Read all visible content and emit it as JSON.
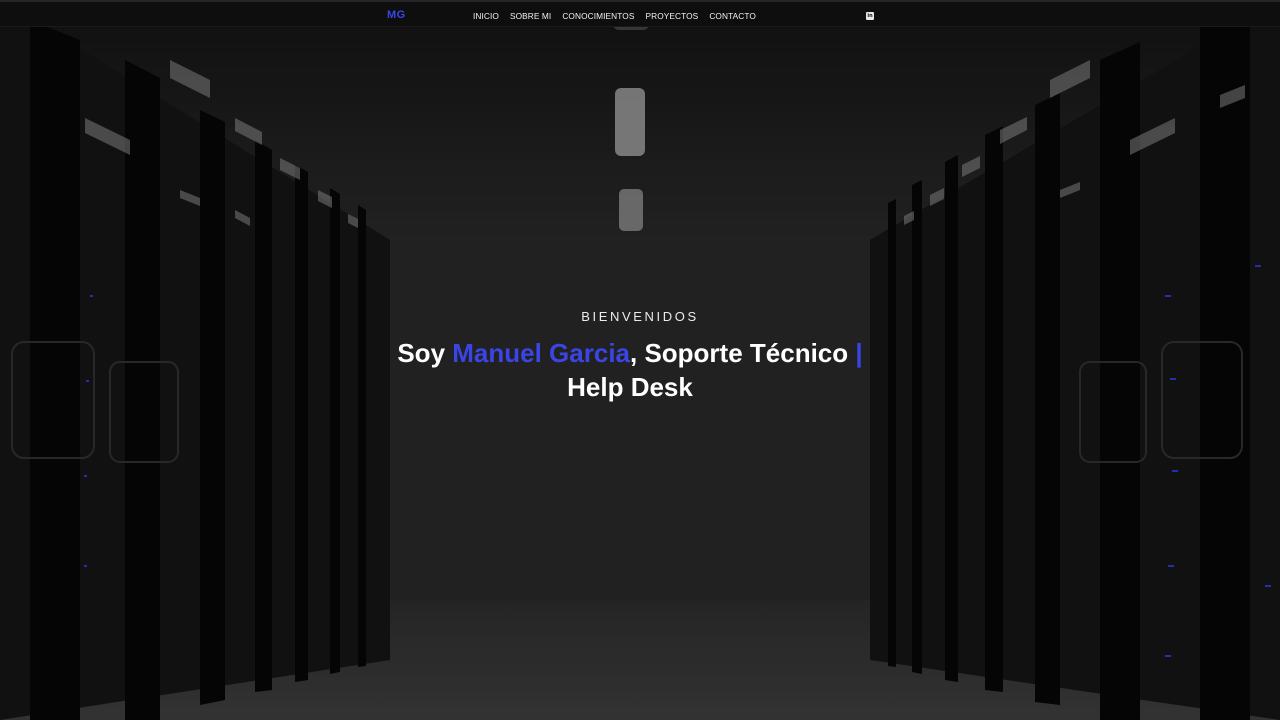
{
  "navbar": {
    "logo": "MG",
    "links": [
      {
        "label": "INICIO"
      },
      {
        "label": "SOBRE MI"
      },
      {
        "label": "CONOCIMIENTOS"
      },
      {
        "label": "PROYECTOS"
      },
      {
        "label": "CONTACTO"
      }
    ],
    "social_icon": "linkedin-icon"
  },
  "hero": {
    "eyebrow": "BIENVENIDOS",
    "heading_prefix": "Soy ",
    "heading_name": "Manuel Garcia",
    "heading_role": ", Soporte Técnico ",
    "heading_cursor": "|",
    "heading_line2": "Help Desk",
    "background": "server-room-photo"
  },
  "colors": {
    "accent": "#3b45e6",
    "navbar_bg": "#0e0e0f",
    "text": "#ffffff"
  }
}
